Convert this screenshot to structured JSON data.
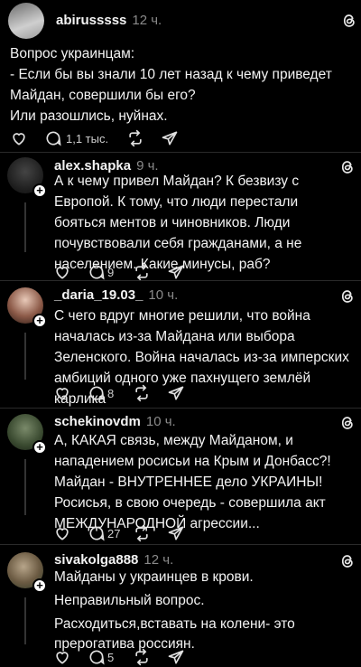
{
  "posts": [
    {
      "username": "abirusssss",
      "time": "12 ч.",
      "lines": [
        "Вопрос украинцам:",
        "- Если бы вы знали 10 лет назад к чему приведет Майдан, совершили бы его?",
        "Или разошлись, нуйнах."
      ],
      "comments": "1,1 тыс."
    },
    {
      "username": "alex.shapka",
      "time": "9 ч.",
      "lines": [
        "А к чему привел Майдан? К безвизу с Европой. К тому, что люди перестали бояться ментов и чиновников. Люди почувствовали себя гражданами, а не населением. Какие минусы, раб?"
      ],
      "comments": "9"
    },
    {
      "username": "_daria_19.03_",
      "time": "10 ч.",
      "lines": [
        "С чего вдруг многие решили, что война началась из-за Майдана или выбора Зеленского. Война началась из-за имперских амбиций одного уже пахнущего землёй карлика"
      ],
      "comments": "8"
    },
    {
      "username": "schekinovdm",
      "time": "10 ч.",
      "lines": [
        "А, КАКАЯ связь, между Майданом, и нападением росисьи на Крым и Донбасс?! Майдан - ВНУТРЕННЕЕ дело УКРАИНЫ! Росисья, в свою очередь - совершила акт МЕЖДУНАРОДНОЙ агрессии..."
      ],
      "comments": "27"
    },
    {
      "username": "sivakolga888",
      "time": "12 ч.",
      "lines": [
        "Майданы у украинцев в крови.",
        "Неправильный вопрос.",
        "Расходиться,вставать на колени- это прерогатива россиян."
      ],
      "comments": "5"
    }
  ],
  "colors": {
    "background": "#000000",
    "text": "#f3f3f3",
    "muted": "#8a8a8a",
    "divider": "#2a2a2a"
  },
  "icons": [
    "threads-icon",
    "heart-icon",
    "comment-icon",
    "repost-icon",
    "share-icon",
    "follow-plus-icon"
  ]
}
